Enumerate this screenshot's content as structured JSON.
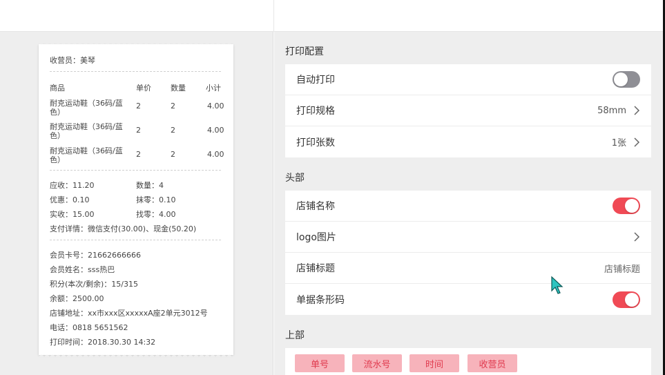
{
  "receipt": {
    "cashier": "收营员：美琴",
    "headers": [
      "商品",
      "单价",
      "数量",
      "小计"
    ],
    "items": [
      {
        "name1": "耐克运动鞋（36码/蓝",
        "name2": "色）",
        "price": "2",
        "qty": "2",
        "subtotal": "4.00"
      },
      {
        "name1": "耐克运动鞋（36码/蓝",
        "name2": "色）",
        "price": "2",
        "qty": "2",
        "subtotal": "4.00"
      },
      {
        "name1": "耐克运动鞋（36码/蓝",
        "name2": "色）",
        "price": "2",
        "qty": "2",
        "subtotal": "4.00"
      }
    ],
    "receivable": "应收：11.20",
    "quantity": "数量：4",
    "discount": "优惠：0.10",
    "rounding": "抹零：0.10",
    "paid": "实收：15.00",
    "change": "找零：4.00",
    "payment_detail": "支付详情：微信支付(30.00)、现金(50.20)",
    "member_card": "会员卡号：21662666666",
    "member_name": "会员姓名：sss热巴",
    "points": "积分(本次/剩余)：15/315",
    "balance": "余额：2500.00",
    "address": "店铺地址：xx市xxx区xxxxxA座2单元3012号",
    "phone": "电话：0818 5651562",
    "print_time": "打印时间：2018.30.30 14:32"
  },
  "print_config": {
    "title": "打印配置",
    "auto_print_label": "自动打印",
    "auto_print_on": false,
    "spec_label": "打印规格",
    "spec_value": "58mm",
    "copies_label": "打印张数",
    "copies_value": "1张"
  },
  "header_section": {
    "title": "头部",
    "store_name_label": "店铺名称",
    "store_name_on": true,
    "logo_label": "logo图片",
    "store_title_label": "店铺标题",
    "store_title_value": "店铺标题",
    "barcode_label": "单据条形码",
    "barcode_on": true
  },
  "upper_section": {
    "title": "上部",
    "chips": [
      "单号",
      "流水号",
      "时间",
      "收营员"
    ]
  },
  "colors": {
    "accent": "#f04a55",
    "toggle_off": "#8f8f95",
    "chip_bg": "#f7b3bb",
    "chip_text": "#e03a4e",
    "background": "#eeeeee"
  }
}
